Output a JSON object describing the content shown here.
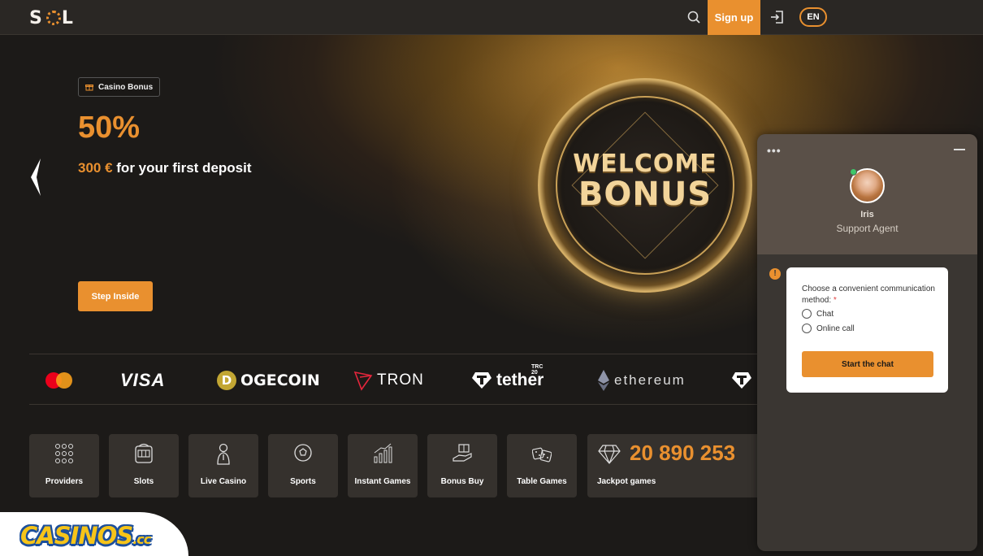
{
  "header": {
    "logo": "S L",
    "signup_label": "Sign up",
    "lang_label": "EN"
  },
  "hero": {
    "badge": "Casino Bonus",
    "percent": "50%",
    "amount": "300 €",
    "subtitle_rest": " for your first deposit",
    "cta": "Step Inside",
    "coin_line1": "WELCOME",
    "coin_line2": "BONUS"
  },
  "payments": {
    "visa": "VISA",
    "dogecoin": "OGECOIN",
    "dogecoin_mark": "D",
    "tron": "TRON",
    "tether": "tether",
    "tether_tag": "TRC 20",
    "ethereum": "ethereum"
  },
  "categories": [
    {
      "label": "Providers",
      "icon": "grid-dots-icon"
    },
    {
      "label": "Slots",
      "icon": "slot-machine-icon"
    },
    {
      "label": "Live Casino",
      "icon": "dealer-icon"
    },
    {
      "label": "Sports",
      "icon": "soccer-ball-icon"
    },
    {
      "label": "Instant Games",
      "icon": "growth-chart-icon"
    },
    {
      "label": "Bonus Buy",
      "icon": "gift-hand-icon"
    },
    {
      "label": "Table Games",
      "icon": "dice-icon"
    }
  ],
  "jackpot": {
    "value": "20 890 253",
    "label": "Jackpot games"
  },
  "chat": {
    "menu": "•••",
    "agent_name": "Iris",
    "agent_role": "Support Agent",
    "question": "Choose a convenient communication method:",
    "required_mark": "*",
    "options": [
      "Chat",
      "Online call"
    ],
    "start_label": "Start the chat",
    "alert": "!"
  },
  "watermark": {
    "text": "CASINOS",
    "suffix": ".cc"
  },
  "colors": {
    "accent": "#e9902f",
    "background": "#1c1a18",
    "tile": "#35312d"
  }
}
